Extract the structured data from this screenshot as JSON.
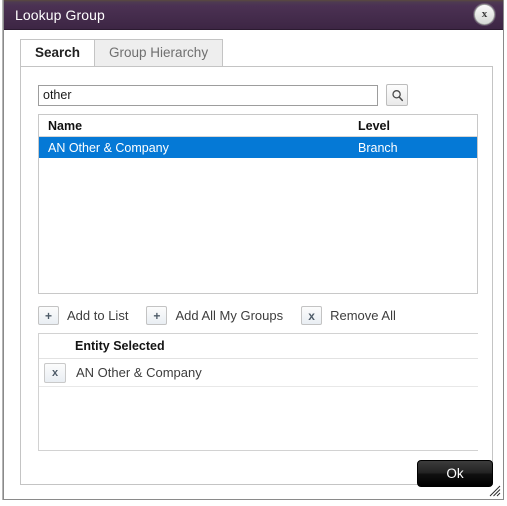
{
  "window": {
    "title": "Lookup Group",
    "close_label": "x",
    "close_icon": "close-circle-icon"
  },
  "tabs": [
    {
      "label": "Search",
      "active": true
    },
    {
      "label": "Group Hierarchy",
      "active": false
    }
  ],
  "search": {
    "value": "other",
    "placeholder": "",
    "button_icon": "search-icon"
  },
  "results": {
    "columns": [
      "Name",
      "Level"
    ],
    "rows": [
      {
        "name": "AN Other & Company",
        "level": "Branch",
        "selected": true
      }
    ]
  },
  "actions": [
    {
      "icon": "plus-icon",
      "icon_glyph": "+",
      "label": "Add to List"
    },
    {
      "icon": "plus-icon",
      "icon_glyph": "+",
      "label": "Add All My Groups"
    },
    {
      "icon": "x-icon",
      "icon_glyph": "x",
      "label": "Remove All"
    }
  ],
  "entity_panel": {
    "header": "Entity Selected",
    "rows": [
      {
        "remove_glyph": "x",
        "name": "AN Other & Company"
      }
    ]
  },
  "footer": {
    "ok_label": "Ok"
  },
  "colors": {
    "titlebar_top": "#4b3153",
    "titlebar_bottom": "#3d2644",
    "selection_blue": "#0579d6",
    "ok_button": "#111111"
  }
}
